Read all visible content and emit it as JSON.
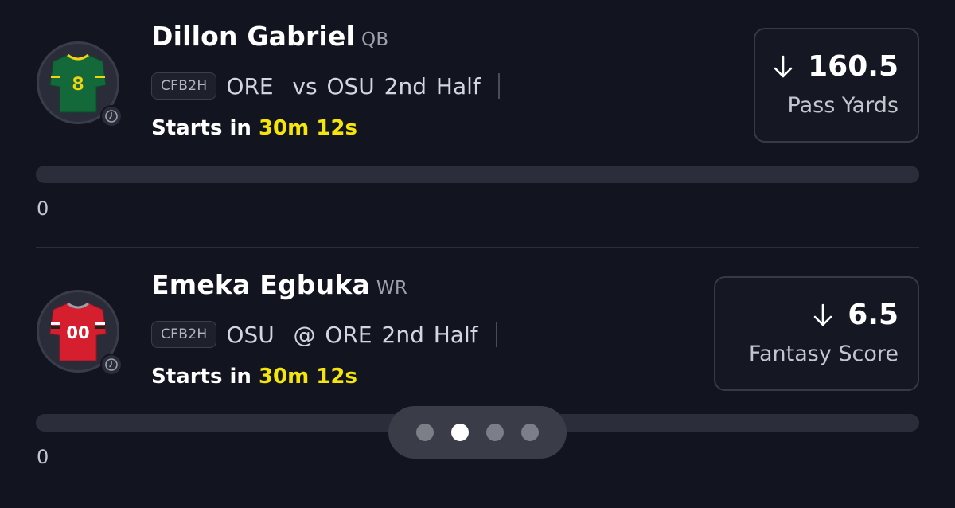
{
  "picks": [
    {
      "player_name": "Dillon Gabriel",
      "position": "QB",
      "league": "CFB2H",
      "matchup": "ORE  vs OSU 2nd Half",
      "starts_prefix": "Starts in",
      "starts_time": "30m 12s",
      "line_direction": "down",
      "line_value": "160.5",
      "stat_type": "Pass Yards",
      "progress_value": "0",
      "progress_fraction": 0,
      "jersey": {
        "number": "8",
        "color": "#13693a",
        "trim": "#f2d30f",
        "icon": "jersey-icon"
      }
    },
    {
      "player_name": "Emeka Egbuka",
      "position": "WR",
      "league": "CFB2H",
      "matchup": "OSU  @ ORE 2nd Half",
      "starts_prefix": "Starts in",
      "starts_time": "30m 12s",
      "line_direction": "down",
      "line_value": "6.5",
      "stat_type": "Fantasy Score",
      "progress_value": "0",
      "progress_fraction": 0,
      "jersey": {
        "number": "00",
        "color": "#d51f2e",
        "trim": "#9da0a8",
        "icon": "jersey-icon"
      }
    }
  ],
  "pager": {
    "total": 4,
    "active_index": 1
  },
  "colors": {
    "background": "#121520",
    "accent_yellow": "#f5e50a"
  }
}
